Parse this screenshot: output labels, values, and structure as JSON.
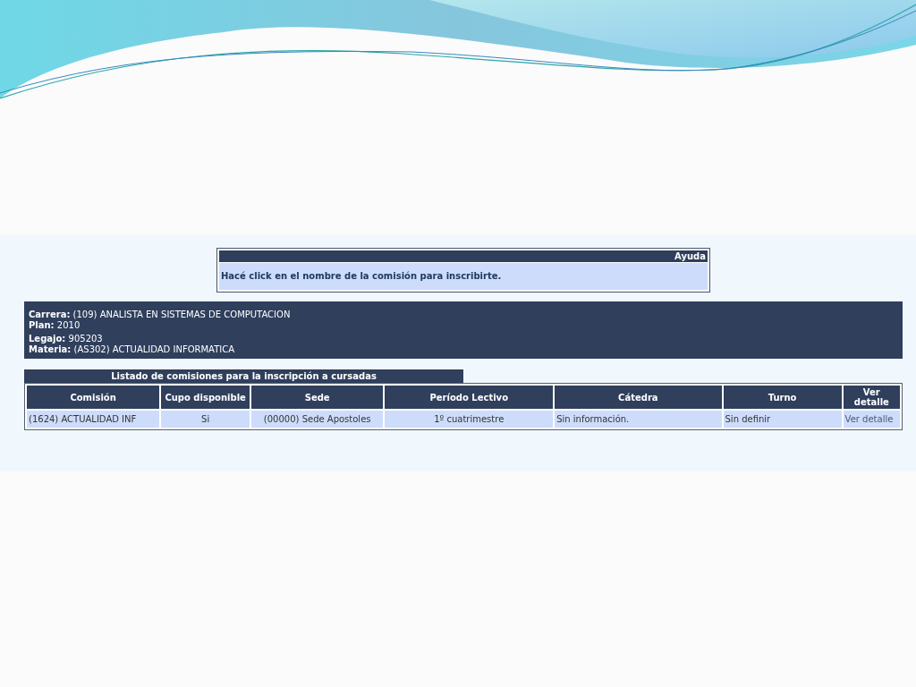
{
  "help": {
    "title": "Ayuda",
    "text": "Hacé click en el nombre de la comisión para inscribirte."
  },
  "info": [
    "**Carrera:** (109) ANALISTA EN SISTEMAS DE COMPUTACION",
    "**Plan:** 2010",
    "**Legajo:** 905203",
    "**Materia:** (AS302) ACTUALIDAD INFORMATICA"
  ],
  "table": {
    "title": "Listado de comisiones para la inscripción a cursadas",
    "columns": [
      {
        "label": "Comisión",
        "kind": "text"
      },
      {
        "label": "Cupo disponible",
        "kind": "center"
      },
      {
        "label": "Sede",
        "kind": "center"
      },
      {
        "label": "Período Lectivo",
        "kind": "center"
      },
      {
        "label": "Cátedra",
        "kind": "text"
      },
      {
        "label": "Turno",
        "kind": "text"
      },
      {
        "label": "Ver detalle",
        "kind": "link"
      }
    ],
    "rows": [
      [
        "(1624) ACTUALIDAD INF",
        "Si",
        "(00000) Sede Apostoles",
        "1º cuatrimestre",
        "Sin información.",
        "Sin definir",
        "Ver detalle"
      ]
    ]
  }
}
